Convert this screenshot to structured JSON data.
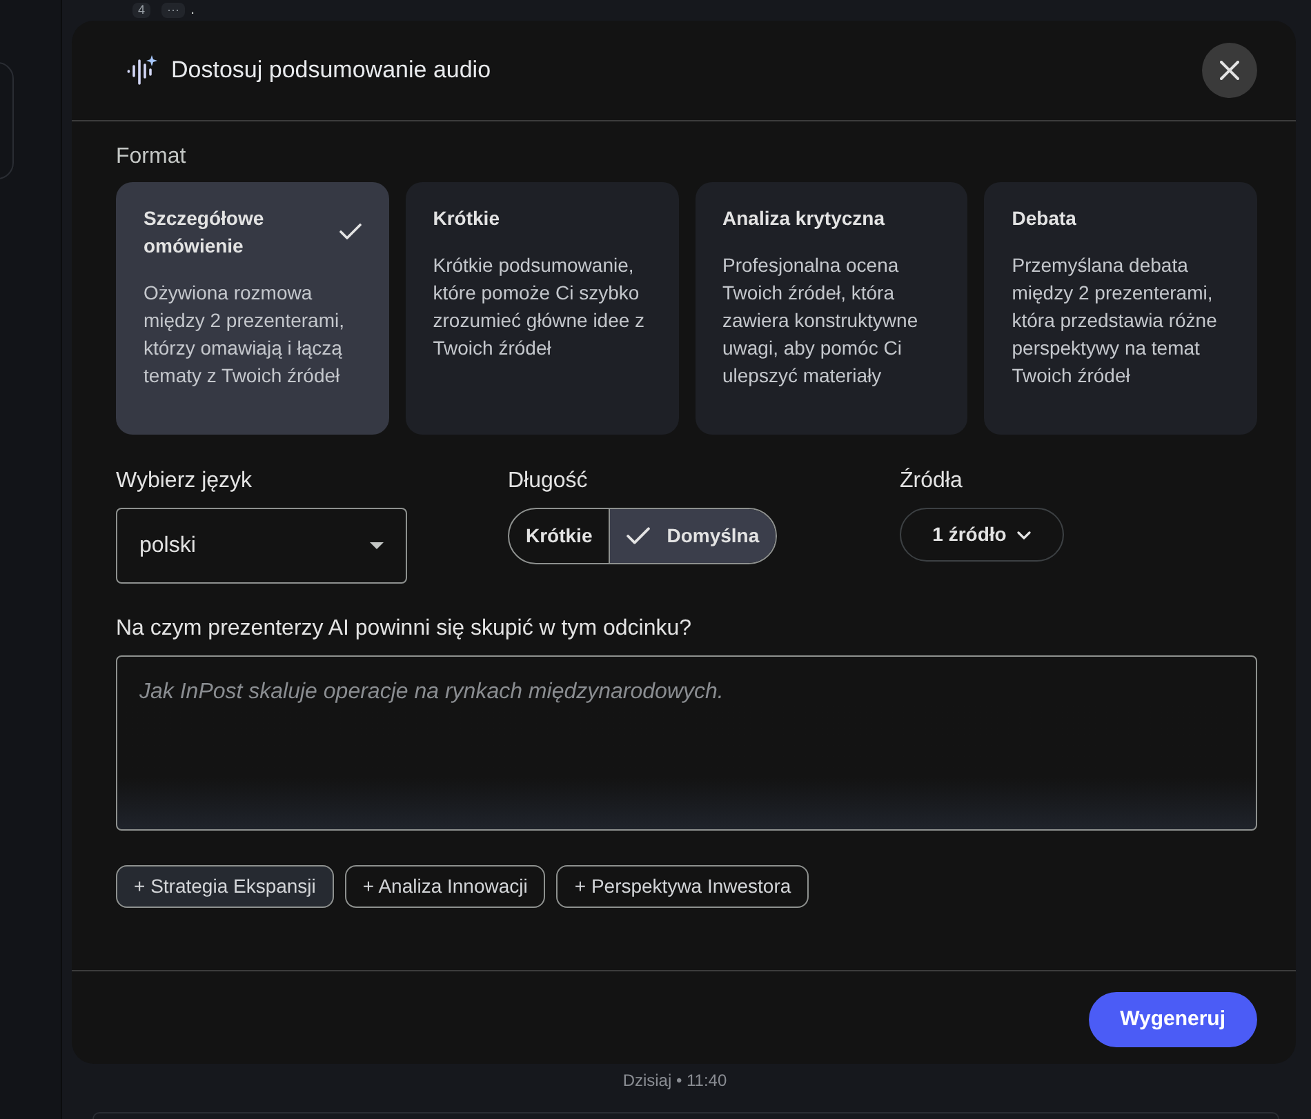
{
  "background": {
    "badges": [
      "4",
      "···"
    ],
    "trailing_text": "."
  },
  "dialog": {
    "title": "Dostosuj podsumowanie audio"
  },
  "format": {
    "label": "Format",
    "options": [
      {
        "title": "Szczegółowe omówienie",
        "description": "Ożywiona rozmowa między 2 prezenterami, którzy omawiają i łączą tematy z Twoich źródeł",
        "selected": true
      },
      {
        "title": "Krótkie",
        "description": "Krótkie podsumowanie, które pomoże Ci szybko zrozumieć główne idee z Twoich źródeł",
        "selected": false
      },
      {
        "title": "Analiza krytyczna",
        "description": "Profesjonalna ocena Twoich źródeł, która zawiera konstruktywne uwagi, aby pomóc Ci ulepszyć materiały",
        "selected": false
      },
      {
        "title": "Debata",
        "description": "Przemyślana debata między 2 prezenterami, która przedstawia różne perspektywy na temat Twoich źródeł",
        "selected": false
      }
    ]
  },
  "language": {
    "label": "Wybierz język",
    "value": "polski"
  },
  "length": {
    "label": "Długość",
    "options": [
      {
        "label": "Krótkie",
        "selected": false
      },
      {
        "label": "Domyślna",
        "selected": true
      }
    ]
  },
  "sources": {
    "label": "Źródła",
    "button": "1 źródło"
  },
  "focus": {
    "label": "Na czym prezenterzy AI powinni się skupić w tym odcinku?",
    "placeholder": "Jak InPost skaluje operacje na rynkach międzynarodowych.",
    "suggestions": [
      {
        "label": "+ Strategia Ekspansji",
        "highlighted": true
      },
      {
        "label": "+ Analiza Innowacji",
        "highlighted": false
      },
      {
        "label": "+ Perspektywa Inwestora",
        "highlighted": false
      }
    ]
  },
  "footer": {
    "button": "Wygeneruj"
  },
  "timestamp": "Dzisiaj • 11:40"
}
